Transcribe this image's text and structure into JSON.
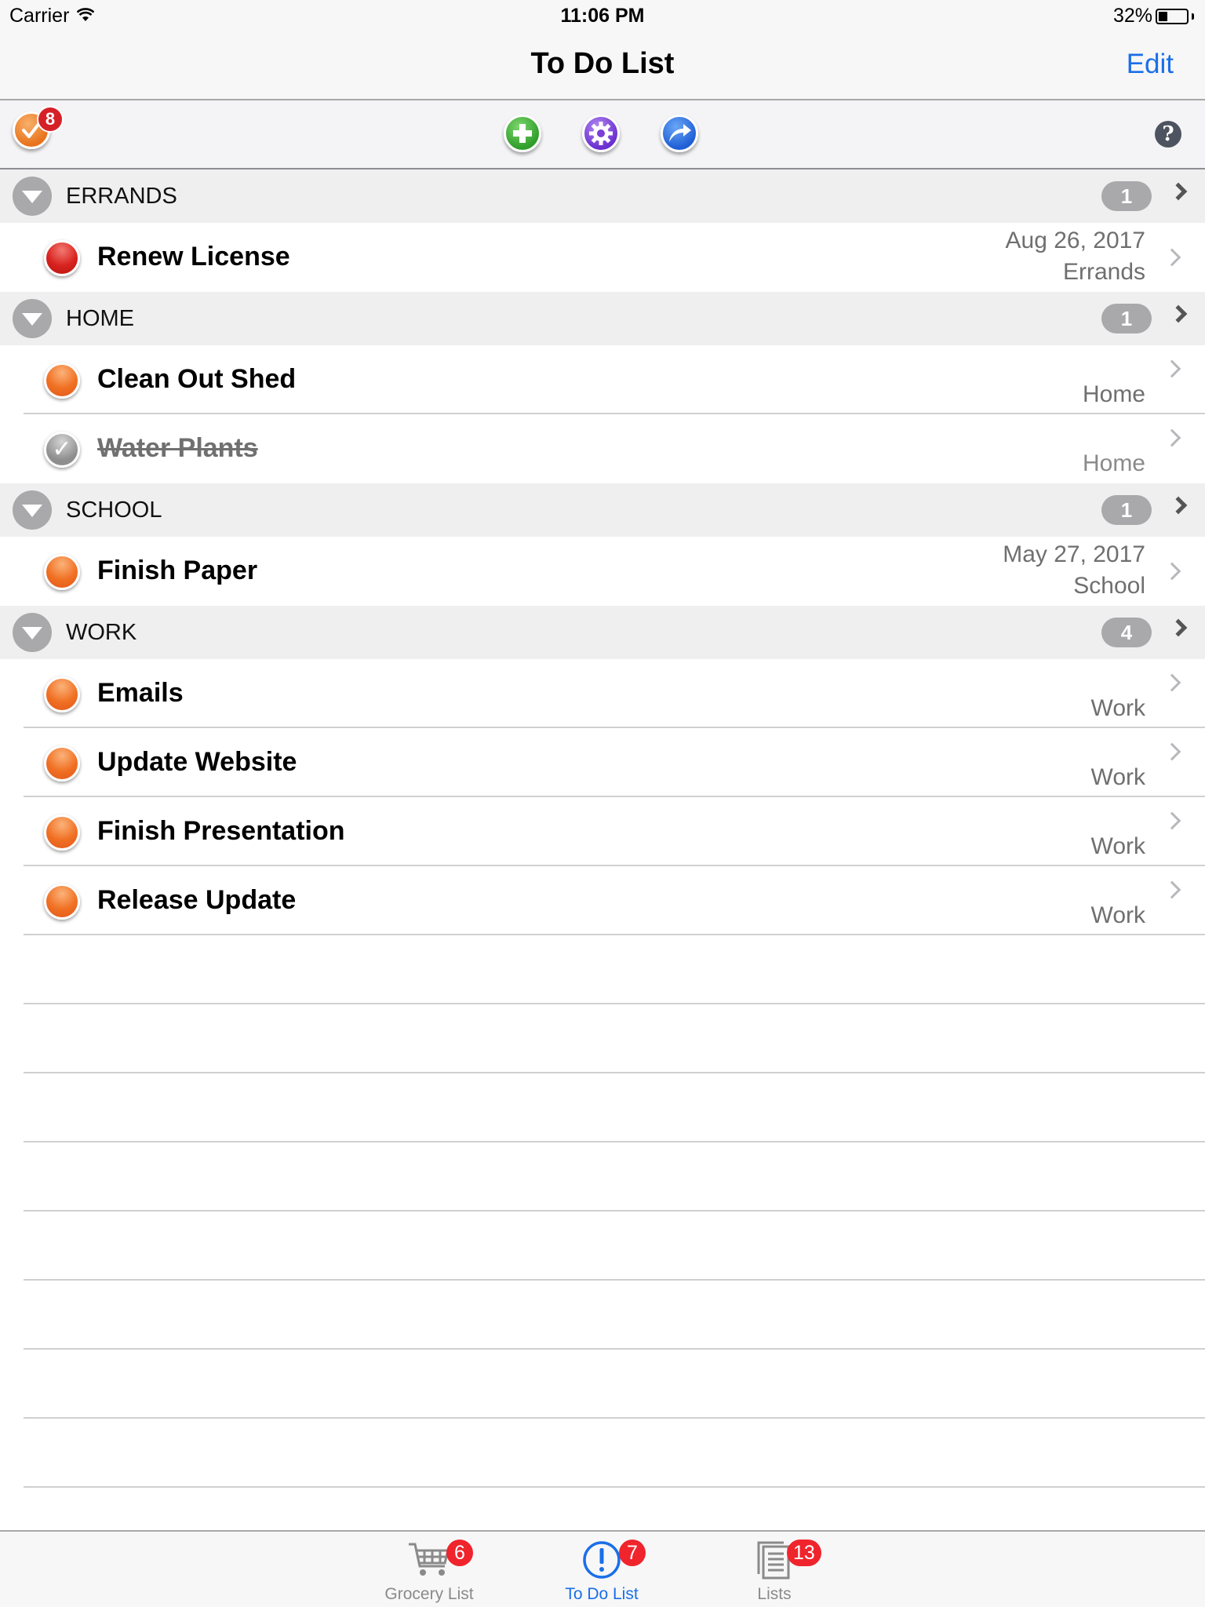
{
  "status_bar": {
    "carrier": "Carrier",
    "time": "11:06 PM",
    "battery_text": "32%",
    "battery_level": 0.32
  },
  "nav": {
    "title": "To Do List",
    "edit_label": "Edit"
  },
  "toolbar": {
    "tasks_badge": "8",
    "help_glyph": "?"
  },
  "sections": [
    {
      "name": "ERRANDS",
      "count": "1",
      "items": [
        {
          "title": "Renew License",
          "date": "Aug 26, 2017",
          "category": "Errands",
          "status": "high",
          "done": false
        }
      ]
    },
    {
      "name": "HOME",
      "count": "1",
      "items": [
        {
          "title": "Clean Out Shed",
          "date": "",
          "category": "Home",
          "status": "normal",
          "done": false
        },
        {
          "title": "Water Plants",
          "date": "",
          "category": "Home",
          "status": "done",
          "done": true
        }
      ]
    },
    {
      "name": "SCHOOL",
      "count": "1",
      "items": [
        {
          "title": "Finish Paper",
          "date": "May 27, 2017",
          "category": "School",
          "status": "normal",
          "done": false
        }
      ]
    },
    {
      "name": "WORK",
      "count": "4",
      "items": [
        {
          "title": "Emails",
          "date": "",
          "category": "Work",
          "status": "normal",
          "done": false
        },
        {
          "title": "Update Website",
          "date": "",
          "category": "Work",
          "status": "normal",
          "done": false
        },
        {
          "title": "Finish Presentation",
          "date": "",
          "category": "Work",
          "status": "normal",
          "done": false
        },
        {
          "title": "Release Update",
          "date": "",
          "category": "Work",
          "status": "normal",
          "done": false
        }
      ]
    }
  ],
  "tabs": [
    {
      "label": "Grocery List",
      "badge": "6",
      "icon": "cart-icon",
      "active": false
    },
    {
      "label": "To Do List",
      "badge": "7",
      "icon": "exclamation-circle-icon",
      "active": true
    },
    {
      "label": "Lists",
      "badge": "13",
      "icon": "document-stack-icon",
      "active": false
    }
  ],
  "colors": {
    "accent": "#1a6fe8",
    "badge_red": "#f0242c",
    "priority_high": "#d8221e",
    "priority_normal": "#f07023",
    "done_gray": "#8e8e8e"
  }
}
